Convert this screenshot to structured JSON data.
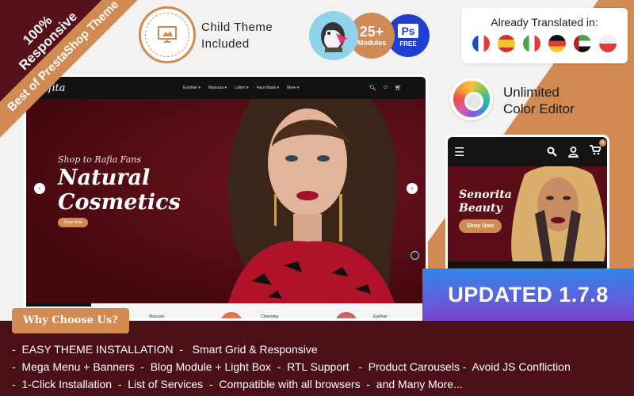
{
  "corner_ribbon": {
    "headline": "100% Responsive",
    "band": "Best of PrestaShop Theme"
  },
  "child_theme": {
    "line1": "Child Theme",
    "line2": "Included",
    "icon": "monitor-icon"
  },
  "badges": {
    "prestashop": {
      "icon": "puffin-icon"
    },
    "modules": {
      "count": "25+",
      "label": "Modules"
    },
    "photoshop": {
      "label": "Ps",
      "sub": "FREE"
    }
  },
  "translations": {
    "title": "Already Translated in:",
    "flags": [
      "France",
      "Spain",
      "Italy",
      "Germany",
      "UAE",
      "Poland"
    ]
  },
  "color_editor": {
    "line1": "Unlimited",
    "line2": "Color Editor"
  },
  "desktop_preview": {
    "logo": "Rafita",
    "menu": [
      "Eyeliner ▾",
      "Mascara ▾",
      "Lotion ▾",
      "Face Mask ▾",
      "More ▾"
    ],
    "hero_tagline": "Shop to Rafia Fans",
    "hero_title_1": "Natural",
    "hero_title_2": "Cosmetics",
    "hero_button": "Shop Now",
    "prev_arrow": "‹",
    "next_arrow": "›",
    "categories": [
      "Mascara",
      "Cleansing",
      "Eyeliner"
    ]
  },
  "mobile_preview": {
    "cart_count": "5",
    "hero_title_1": "Senorita",
    "hero_title_2": "Beauty",
    "hero_button": "Shop Now"
  },
  "updated_banner": "UPDATED 1.7.8",
  "why_choose": "Why Choose Us?",
  "features": [
    "-  EASY THEME INSTALLATION  -   Smart Grid & Responsive",
    "-  Mega Menu + Banners  -  Blog Module + Light Box  -  RTL Support   -  Product Carousels -  Avoid JS Confliction",
    "-  1-Click Installation  -  List of Services  -  Compatible with all browsers  -  and Many More..."
  ],
  "colors": {
    "accent_orange": "#d08a52",
    "dark_maroon": "#4a0f17",
    "updated_gradient_top": "#3288ea",
    "updated_gradient_bottom": "#7a45d0"
  }
}
